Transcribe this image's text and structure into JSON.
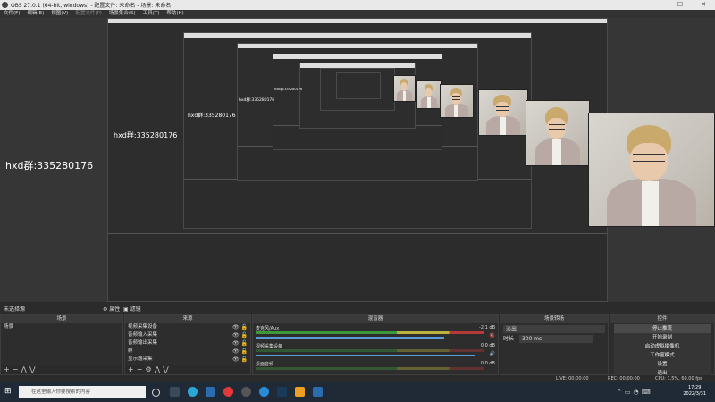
{
  "window": {
    "title": "OBS 27.0.1 (64-bit, windows) - 配置文件: 未命名 - 场景: 未命名",
    "minimize": "─",
    "maximize": "☐",
    "close": "✕"
  },
  "menu": [
    "文件(F)",
    "编辑(E)",
    "视图(V)",
    "配置文件(P)",
    "场景集合(S)",
    "工具(T)",
    "帮助(H)"
  ],
  "watermark": "hxd群:335280176",
  "dock_status": {
    "no_source": "未选择源",
    "properties": "属性",
    "filters": "滤镜"
  },
  "scenes": {
    "title": "场景",
    "items": [
      "场景"
    ]
  },
  "sources": {
    "title": "来源",
    "items": [
      "视频采集设备",
      "音频输入采集",
      "音频输出采集",
      "群",
      "显示器采集"
    ]
  },
  "mixer": {
    "title": "混音器",
    "channels": [
      {
        "name": "麦克风/Aux",
        "db": "-2.1 dB",
        "level": 0.86
      },
      {
        "name": "视频采集设备",
        "db": "0.0 dB",
        "level": 1.0
      },
      {
        "name": "桌面音频",
        "db": "0.0 dB",
        "level": 0.98
      }
    ]
  },
  "transitions": {
    "title": "场景转场",
    "type_value": "淡出",
    "duration_label": "时长",
    "duration_value": "300 ms"
  },
  "controls": {
    "title": "控件",
    "buttons": [
      "停止推流",
      "开始录制",
      "启动虚拟摄像机",
      "工作室模式",
      "设置",
      "退出"
    ]
  },
  "statusbar": {
    "live": "LIVE: 00:00:00",
    "rec": "REC: 00:00:00",
    "cpu": "CPU: 1.5%, 60.00 fps"
  },
  "taskbar": {
    "search_placeholder": "在这里输入你要搜索的内容",
    "time": "17:29",
    "date": "2022/3/31"
  }
}
